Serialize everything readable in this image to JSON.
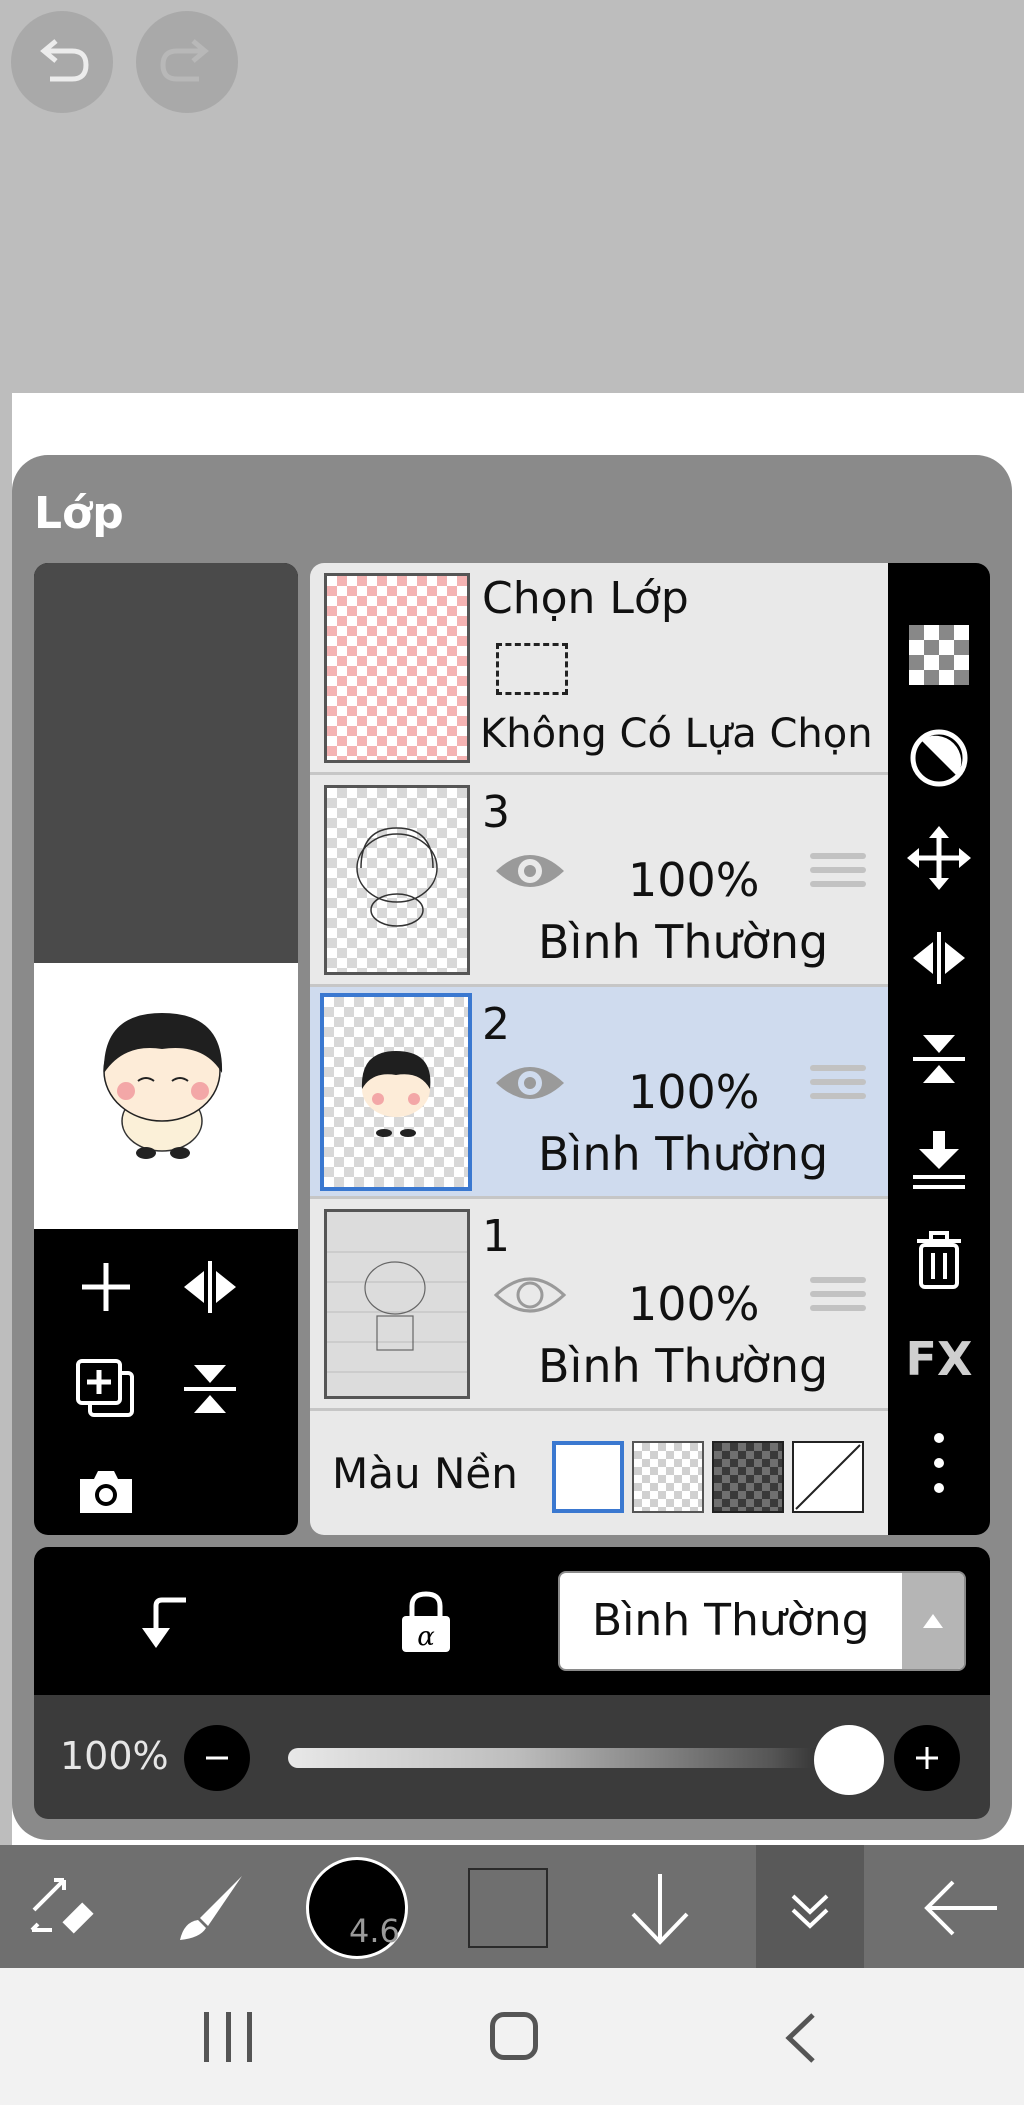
{
  "panel": {
    "title": "Lớp"
  },
  "selection_row": {
    "title": "Chọn Lớp",
    "status": "Không Có Lựa Chọn"
  },
  "layers": [
    {
      "number": "3",
      "opacity": "100%",
      "blend": "Bình Thường",
      "visible": true,
      "selected": false
    },
    {
      "number": "2",
      "opacity": "100%",
      "blend": "Bình Thường",
      "visible": true,
      "selected": true
    },
    {
      "number": "1",
      "opacity": "100%",
      "blend": "Bình Thường",
      "visible": false,
      "selected": false
    }
  ],
  "background": {
    "label": "Màu Nền",
    "options": [
      "white",
      "light-checker",
      "dark-checker",
      "none"
    ],
    "selected": "white"
  },
  "blend_select": {
    "value": "Bình Thường"
  },
  "opacity_slider": {
    "label": "100%",
    "value": 1.0
  },
  "toolbar": {
    "brush_size": "4.6"
  },
  "right_tools": [
    "checker-icon",
    "half-circle-icon",
    "move-icon",
    "flip-horizontal-icon",
    "flip-vertical-icon",
    "merge-down-icon",
    "trash-icon",
    "fx-icon",
    "more-vertical-icon"
  ],
  "right_tools_fx_label": "FX",
  "colors": {
    "selected_row": "#cfdbee",
    "selected_border": "#3a78d0",
    "selection_thumb": "#f4b3b3"
  }
}
